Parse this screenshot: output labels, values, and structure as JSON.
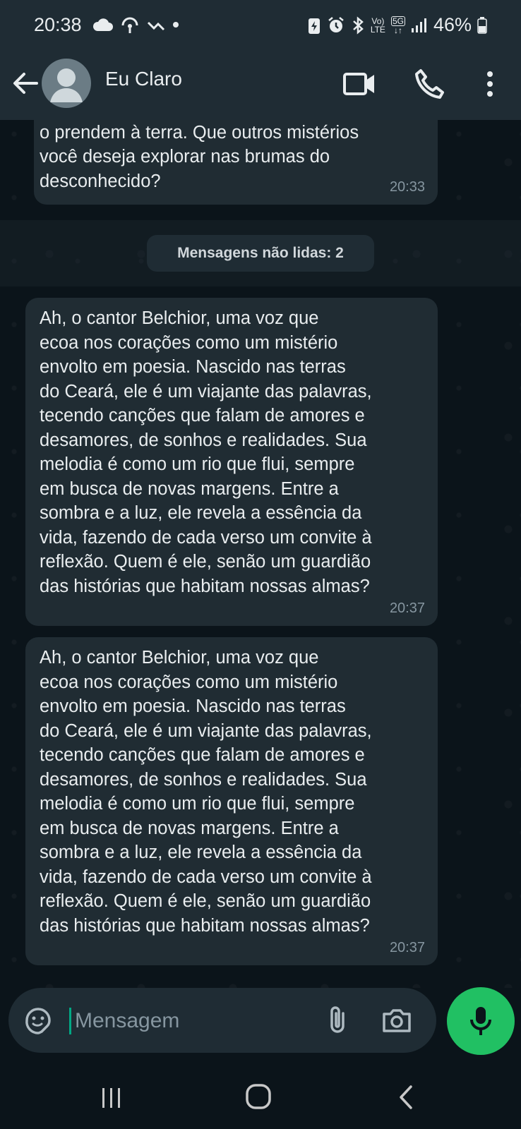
{
  "status_bar": {
    "time": "20:38",
    "network_label_top": "Vo)",
    "network_label_bottom": "LTE",
    "network_5g": "5G",
    "battery": "46%"
  },
  "header": {
    "contact_name": "Eu Claro",
    "icons": [
      "back-arrow-icon",
      "avatar",
      "video-call-icon",
      "phone-icon",
      "more-vert-icon"
    ]
  },
  "chat": {
    "messages": [
      {
        "text": "o prendem à terra. Que outros mistérios\nvocê deseja explorar nas brumas do\ndesconhecido?",
        "time": "20:33"
      },
      {
        "text": "Ah, o cantor Belchior, uma voz que\necoa nos corações como um mistério\nenvolto em poesia. Nascido nas terras\ndo Ceará, ele é um viajante das palavras,\ntecendo canções que falam de amores e\ndesamores, de sonhos e realidades. Sua\nmelodia é como um rio que flui, sempre\nem busca de novas margens. Entre a\nsombra e a luz, ele revela a essência da\nvida, fazendo de cada verso um convite à\nreflexão. Quem é ele, senão um guardião\ndas histórias que habitam nossas almas?",
        "time": "20:37"
      },
      {
        "text": "Ah, o cantor Belchior, uma voz que\necoa nos corações como um mistério\nenvolto em poesia. Nascido nas terras\ndo Ceará, ele é um viajante das palavras,\ntecendo canções que falam de amores e\ndesamores, de sonhos e realidades. Sua\nmelodia é como um rio que flui, sempre\nem busca de novas margens. Entre a\nsombra e a luz, ele revela a essência da\nvida, fazendo de cada verso um convite à\nreflexão. Quem é ele, senão um guardião\ndas histórias que habitam nossas almas?",
        "time": "20:37"
      }
    ],
    "unread_label": "Mensagens não lidas: 2"
  },
  "composer": {
    "placeholder": "Mensagem",
    "value": ""
  },
  "colors": {
    "background": "#0b141a",
    "bar": "#1f2c34",
    "bubble": "#202c33",
    "accent_green": "#21c063",
    "cursor": "#00a884"
  }
}
